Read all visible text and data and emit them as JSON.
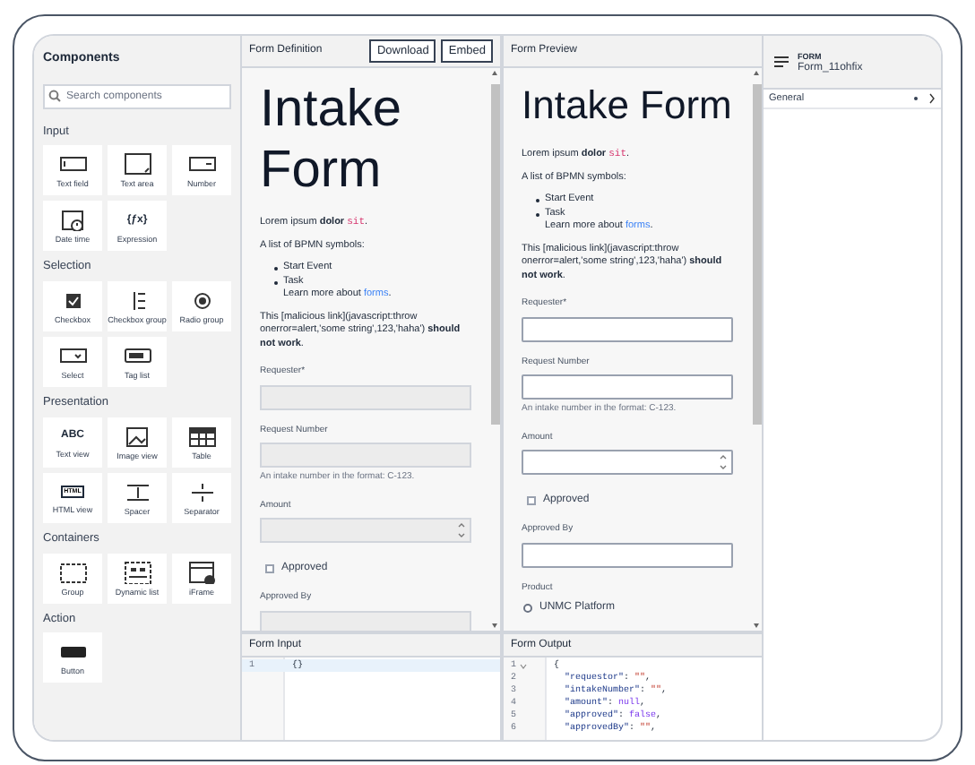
{
  "sidebar": {
    "title": "Components",
    "search": {
      "placeholder": "Search components"
    },
    "groups": [
      {
        "label": "Input",
        "items": [
          {
            "label": "Text field"
          },
          {
            "label": "Text area"
          },
          {
            "label": "Number"
          },
          {
            "label": "Date time"
          },
          {
            "label": "Expression",
            "glyph": "{ƒx}"
          }
        ]
      },
      {
        "label": "Selection",
        "items": [
          {
            "label": "Checkbox"
          },
          {
            "label": "Checkbox group"
          },
          {
            "label": "Radio group"
          },
          {
            "label": "Select"
          },
          {
            "label": "Tag list"
          }
        ]
      },
      {
        "label": "Presentation",
        "items": [
          {
            "label": "Text view",
            "glyph": "ABC"
          },
          {
            "label": "Image view"
          },
          {
            "label": "Table"
          },
          {
            "label": "HTML view",
            "glyph": "HTML"
          },
          {
            "label": "Spacer"
          },
          {
            "label": "Separator"
          }
        ]
      },
      {
        "label": "Containers",
        "items": [
          {
            "label": "Group"
          },
          {
            "label": "Dynamic list"
          },
          {
            "label": "iFrame"
          }
        ]
      },
      {
        "label": "Action",
        "items": [
          {
            "label": "Button"
          }
        ]
      }
    ]
  },
  "definition": {
    "title": "Form Definition",
    "buttons": [
      "Download",
      "Embed"
    ],
    "form": {
      "editable": false,
      "blocks": [
        {
          "kind": "heading",
          "text": "Intake Form"
        },
        {
          "kind": "paragraph",
          "segments": [
            {
              "kind": "text",
              "text": "Lorem ipsum **dolor** "
            },
            {
              "kind": "code",
              "text": "sit"
            },
            {
              "kind": "text",
              "text": "."
            }
          ]
        },
        {
          "kind": "paragraph",
          "segments": [
            {
              "kind": "text",
              "text": "A list of BPMN symbols:"
            }
          ]
        },
        {
          "kind": "list",
          "items": [
            {
              "text": "Start Event"
            },
            {
              "text": "Task",
              "detail": {
                "before": "Learn more about ",
                "link": "forms",
                "after": "."
              }
            }
          ]
        },
        {
          "kind": "paragraph",
          "segments": [
            {
              "kind": "text",
              "text": "This [malicious link](javascript:throw onerror=alert,'some string',123,'haha') **should not work**."
            }
          ]
        },
        {
          "kind": "textfield",
          "label": "Requester*"
        },
        {
          "kind": "textfield",
          "label": "Request Number",
          "description": "An intake number in the format: C-123."
        },
        {
          "kind": "number",
          "label": "Amount"
        },
        {
          "kind": "checkbox",
          "label": "Approved",
          "checked": false
        },
        {
          "kind": "textfield",
          "label": "Approved By"
        }
      ]
    }
  },
  "preview": {
    "title": "Form Preview",
    "form": {
      "editable": true,
      "blocks": [
        {
          "kind": "heading",
          "text": "Intake Form"
        },
        {
          "kind": "paragraph",
          "segments": [
            {
              "kind": "text",
              "text": "Lorem ipsum **dolor** "
            },
            {
              "kind": "code",
              "text": "sit"
            },
            {
              "kind": "text",
              "text": "."
            }
          ]
        },
        {
          "kind": "paragraph",
          "segments": [
            {
              "kind": "text",
              "text": "A list of BPMN symbols:"
            }
          ]
        },
        {
          "kind": "list",
          "items": [
            {
              "text": "Start Event"
            },
            {
              "text": "Task",
              "detail": {
                "before": "Learn more about ",
                "link": "forms",
                "after": "."
              }
            }
          ]
        },
        {
          "kind": "paragraph",
          "segments": [
            {
              "kind": "text",
              "text": "This [malicious link](javascript:throw onerror=alert,'some string',123,'haha') **should not work**."
            }
          ]
        },
        {
          "kind": "textfield",
          "label": "Requester*"
        },
        {
          "kind": "textfield",
          "label": "Request Number",
          "description": "An intake number in the format: C-123."
        },
        {
          "kind": "number",
          "label": "Amount"
        },
        {
          "kind": "checkbox",
          "label": "Approved",
          "checked": false
        },
        {
          "kind": "textfield",
          "label": "Approved By"
        },
        {
          "kind": "radio",
          "label": "Product",
          "options": [
            {
              "label": "UNMC Platform",
              "selected": false
            }
          ]
        }
      ]
    }
  },
  "input": {
    "title": "Form Input",
    "lines": [
      {
        "number": "1",
        "selected": true,
        "foldable": false,
        "tokens": [
          {
            "kind": "punct",
            "text": "{}"
          }
        ]
      }
    ]
  },
  "output": {
    "title": "Form Output",
    "lines": [
      {
        "number": "1",
        "selected": false,
        "foldable": true,
        "tokens": [
          {
            "kind": "punct",
            "text": "{"
          }
        ]
      },
      {
        "number": "2",
        "selected": false,
        "foldable": false,
        "tokens": [
          {
            "kind": "key",
            "text": "  \"requestor\""
          },
          {
            "kind": "punct",
            "text": ": "
          },
          {
            "kind": "string",
            "text": "\"\""
          },
          {
            "kind": "punct",
            "text": ","
          }
        ]
      },
      {
        "number": "3",
        "selected": false,
        "foldable": false,
        "tokens": [
          {
            "kind": "key",
            "text": "  \"intakeNumber\""
          },
          {
            "kind": "punct",
            "text": ": "
          },
          {
            "kind": "string",
            "text": "\"\""
          },
          {
            "kind": "punct",
            "text": ","
          }
        ]
      },
      {
        "number": "4",
        "selected": false,
        "foldable": false,
        "tokens": [
          {
            "kind": "key",
            "text": "  \"amount\""
          },
          {
            "kind": "punct",
            "text": ": "
          },
          {
            "kind": "atom",
            "text": "null"
          },
          {
            "kind": "punct",
            "text": ","
          }
        ]
      },
      {
        "number": "5",
        "selected": false,
        "foldable": false,
        "tokens": [
          {
            "kind": "key",
            "text": "  \"approved\""
          },
          {
            "kind": "punct",
            "text": ": "
          },
          {
            "kind": "atom",
            "text": "false"
          },
          {
            "kind": "punct",
            "text": ","
          }
        ]
      },
      {
        "number": "6",
        "selected": false,
        "foldable": false,
        "tokens": [
          {
            "kind": "key",
            "text": "  \"approvedBy\""
          },
          {
            "kind": "punct",
            "text": ": "
          },
          {
            "kind": "string",
            "text": "\"\""
          },
          {
            "kind": "punct",
            "text": ","
          }
        ]
      }
    ]
  },
  "properties": {
    "type": "FORM",
    "name": "Form_11ohfix",
    "sections": [
      {
        "label": "General",
        "expanded": false
      }
    ]
  }
}
